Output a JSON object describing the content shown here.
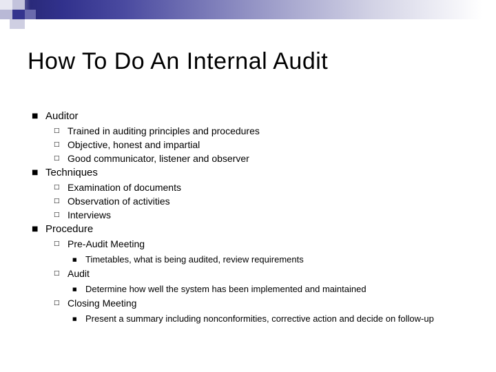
{
  "slide": {
    "title": "How To Do An Internal Audit",
    "theme": {
      "band_dark": "#2a2a7a",
      "band_light": "#ffffff",
      "text_color": "#000000"
    },
    "bullet_glyphs": {
      "level1": "■",
      "level2": "□",
      "level3": "■",
      "level4": "■"
    },
    "outline": [
      {
        "level": 1,
        "text": "Auditor",
        "children": [
          {
            "level": 2,
            "text": "Trained in auditing principles and procedures"
          },
          {
            "level": 2,
            "text": "Objective, honest and impartial"
          },
          {
            "level": 2,
            "text": "Good communicator, listener and observer"
          }
        ]
      },
      {
        "level": 1,
        "text": "Techniques",
        "children": [
          {
            "level": 2,
            "text": "Examination of documents"
          },
          {
            "level": 2,
            "text": "Observation of activities"
          },
          {
            "level": 2,
            "text": "Interviews"
          }
        ]
      },
      {
        "level": 1,
        "text": "Procedure",
        "children": [
          {
            "level": 2,
            "text": "Pre-Audit Meeting",
            "children": [
              {
                "level": 3,
                "text": "Timetables, what is being audited, review requirements"
              }
            ]
          },
          {
            "level": 2,
            "text": "Audit",
            "children": [
              {
                "level": 3,
                "text": "Determine how well the system has been implemented and maintained"
              }
            ]
          },
          {
            "level": 2,
            "text": "Closing Meeting",
            "children": [
              {
                "level": 3,
                "text": "Present a summary including nonconformities, corrective action and decide on follow-up"
              }
            ]
          }
        ]
      }
    ]
  }
}
